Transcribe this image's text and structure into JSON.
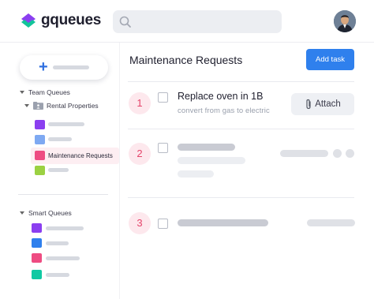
{
  "app": {
    "name": "gqueues"
  },
  "header": {
    "search_placeholder": ""
  },
  "sidebar": {
    "new_button_icon": "plus-icon",
    "team_queues_label": "Team Queues",
    "rental_properties_label": "Rental Properties",
    "active_queue_label": "Maintenance Requests",
    "smart_queues_label": "Smart Queues",
    "team_queue_colors": [
      "#8b3ff0",
      "#7ea9f2",
      "#ee4c82",
      "#9bd142"
    ],
    "smart_queue_colors": [
      "#8b3ff0",
      "#2f80ed",
      "#ee4c82",
      "#10c9a3"
    ]
  },
  "main": {
    "title": "Maintenance Requests",
    "add_task_label": "Add task",
    "tasks": [
      {
        "number": "1",
        "title": "Replace oven in 1B",
        "subtitle": "convert from gas to electric",
        "action_label": "Attach"
      },
      {
        "number": "2"
      },
      {
        "number": "3"
      }
    ]
  },
  "colors": {
    "accent": "#2f80ed",
    "number_badge": "#e5456b",
    "active_row": "#fdeef2"
  }
}
